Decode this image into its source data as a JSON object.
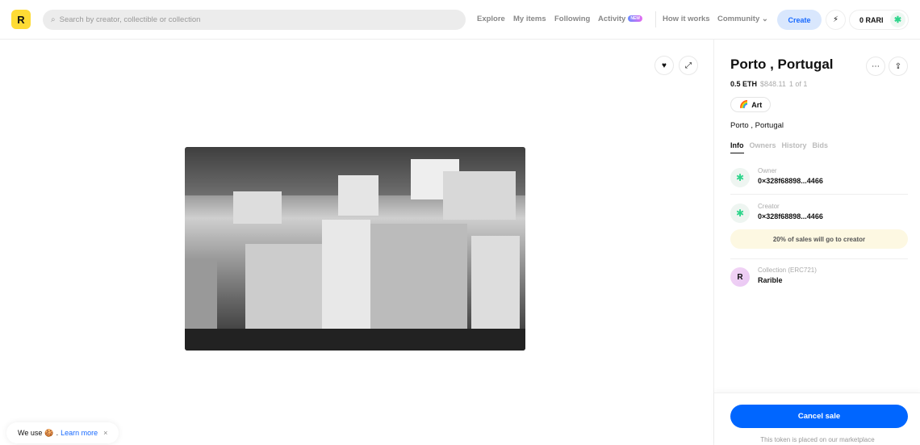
{
  "header": {
    "logo": "R",
    "search_placeholder": "Search by creator, collectible or collection",
    "nav": [
      "Explore",
      "My items",
      "Following",
      "Activity",
      "How it works",
      "Community"
    ],
    "activity_badge": "NEW",
    "create_label": "Create",
    "balance": "0 RARI"
  },
  "item": {
    "title": "Porto , Portugal",
    "price": "0.5 ETH",
    "usd": "$848.11",
    "edition": "1 of 1",
    "category": "Art",
    "description": "Porto , Portugal",
    "tabs": [
      "Info",
      "Owners",
      "History",
      "Bids"
    ],
    "owner_label": "Owner",
    "owner": "0×328f68898...4466",
    "creator_label": "Creator",
    "creator": "0×328f68898...4466",
    "royalty": "20% of sales will go to creator",
    "collection_label": "Collection (ERC721)",
    "collection": "Rarible",
    "cancel_label": "Cancel sale",
    "note": "This token is placed on our marketplace"
  },
  "cookie": {
    "text": "We use",
    "link": "Learn more",
    "close": "×"
  },
  "colors": {
    "accent": "#0066ff",
    "logo": "#fedb35",
    "create_bg": "#d9e7fd",
    "royalty_bg": "#fdf8e2"
  }
}
